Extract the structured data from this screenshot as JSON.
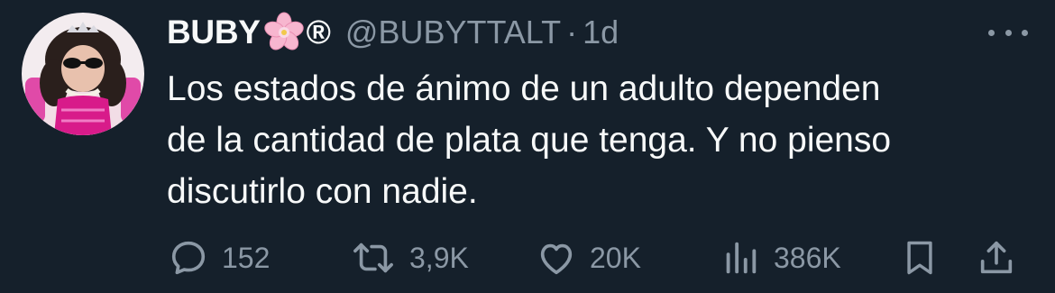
{
  "author": {
    "display_name": "BUBY",
    "reg_mark": "®",
    "handle": "@BUBYTTALT",
    "separator": "·",
    "time": "1d"
  },
  "tweet": {
    "text": "Los estados de ánimo de un adulto dependen\nde la cantidad de plata que tenga. Y no pienso\ndiscutirlo con nadie."
  },
  "actions": {
    "replies": "152",
    "retweets": "3,9K",
    "likes": "20K",
    "views": "386K"
  },
  "icons": {
    "name_emoji": "cherry-blossom-icon",
    "more": "more-horizontal-icon",
    "reply": "speech-bubble-icon",
    "retweet": "retweet-arrows-icon",
    "like": "heart-icon",
    "views": "bar-chart-icon",
    "bookmark": "bookmark-icon",
    "share": "share-upload-icon"
  },
  "colors": {
    "background": "#15202b",
    "text_primary": "#f7f9f9",
    "text_secondary": "#8b98a5"
  }
}
